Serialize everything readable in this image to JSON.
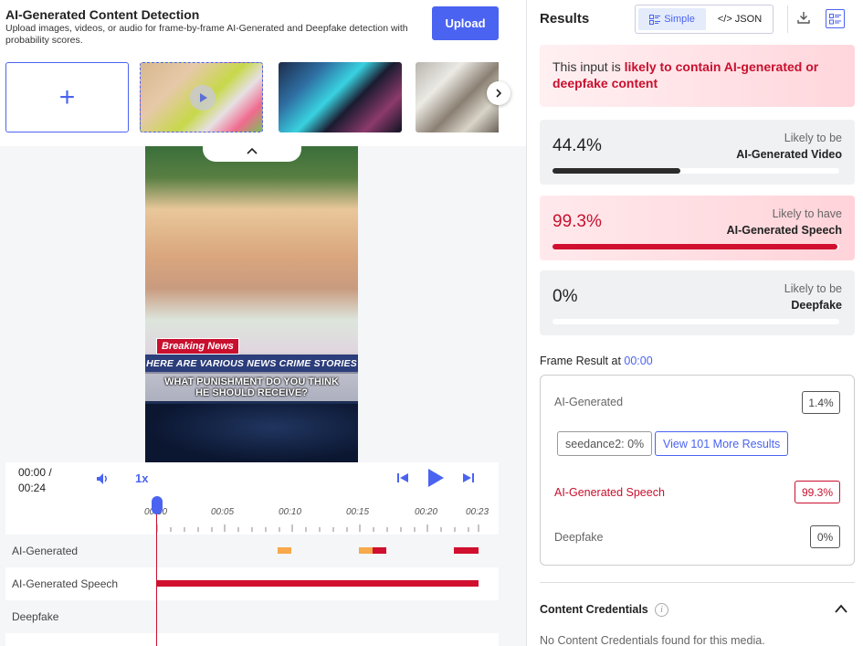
{
  "header": {
    "title": "AI-Generated Content Detection",
    "description": "Upload images, videos, or audio for frame-by-frame AI-Generated and Deepfake detection with probability scores.",
    "upload_label": "Upload"
  },
  "video": {
    "breaking": "Breaking News",
    "headline": "HERE ARE VARIOUS NEWS CRIME STORIES",
    "question_line1": "WHAT PUNISHMENT DO YOU THINK",
    "question_line2": "HE SHOULD RECEIVE?"
  },
  "player": {
    "current_time": "00:00 /",
    "duration": "00:24",
    "speed": "1x"
  },
  "timeline": {
    "ticks": [
      "00:00",
      "00:05",
      "00:10",
      "00:15",
      "00:20",
      "00:23"
    ],
    "tracks": [
      {
        "label": "AI-Generated"
      },
      {
        "label": "AI-Generated Speech"
      },
      {
        "label": "Deepfake"
      }
    ]
  },
  "results": {
    "title": "Results",
    "view_simple": "Simple",
    "view_json": "</> JSON",
    "alert_prefix": "This input is ",
    "alert_highlight": "likely to contain AI-generated or deepfake content",
    "scores": [
      {
        "value": "44.4%",
        "label_line1": "Likely to be",
        "label_line2": "AI-Generated Video",
        "fill": 0.447,
        "color": "#2b2b2b"
      },
      {
        "value": "99.3%",
        "label_line1": "Likely to have",
        "label_line2": "AI-Generated Speech",
        "fill": 0.993,
        "color": "#d0102e"
      },
      {
        "value": "0%",
        "label_line1": "Likely to be",
        "label_line2": "Deepfake",
        "fill": 0,
        "color": "#2b2b2b"
      }
    ],
    "frame_title": "Frame Result at ",
    "frame_time": "00:00",
    "frame": {
      "ai_label": "AI-Generated",
      "ai_value": "1.4%",
      "chip_model": "seedance2: 0%",
      "chip_more": "View 101 More Results",
      "speech_label": "AI-Generated Speech",
      "speech_value": "99.3%",
      "deepfake_label": "Deepfake",
      "deepfake_value": "0%"
    },
    "cc_title": "Content Credentials",
    "cc_message": "No Content Credentials found for this media."
  },
  "colors": {
    "accent": "#4a63f0",
    "danger": "#c8102e",
    "warning": "#f7a94b"
  }
}
